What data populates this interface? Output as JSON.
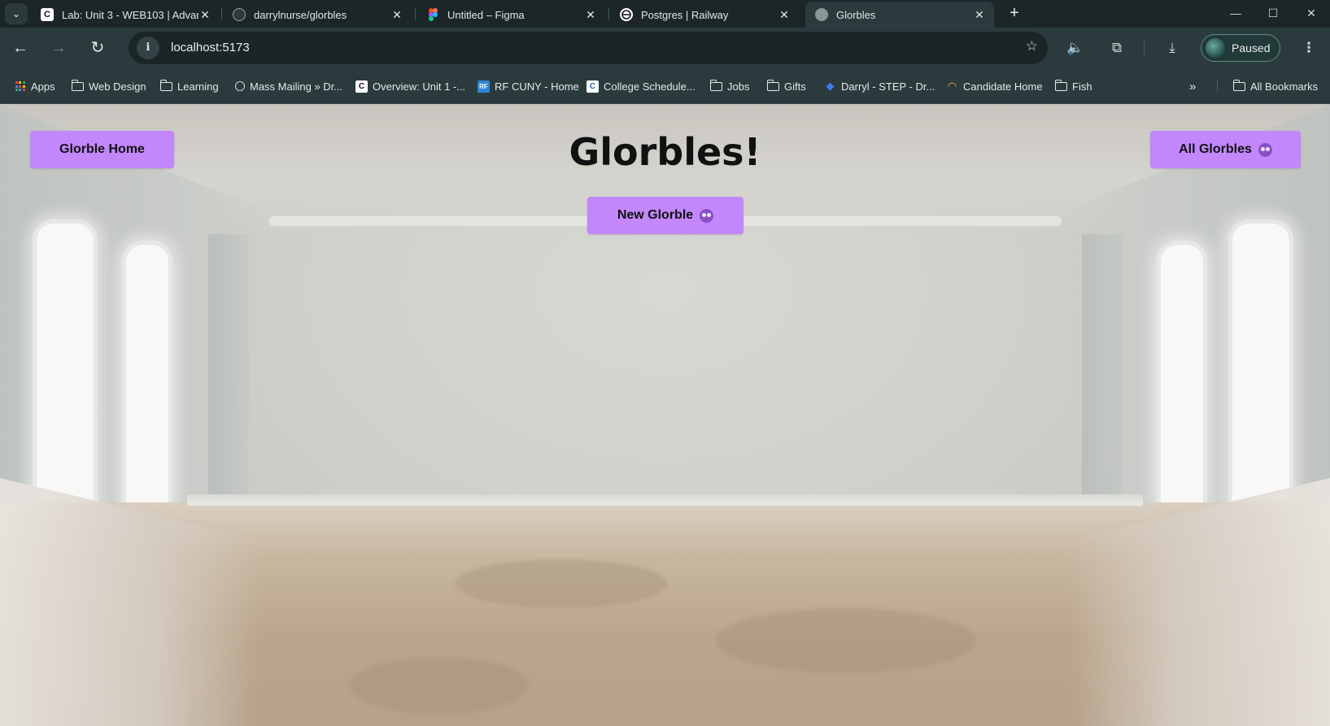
{
  "browser": {
    "tabs": [
      {
        "title": "Lab: Unit 3 - WEB103 | Advar",
        "favicon": "codepath-icon"
      },
      {
        "title": "darrylnurse/glorbles",
        "favicon": "github-icon"
      },
      {
        "title": "Untitled – Figma",
        "favicon": "figma-icon"
      },
      {
        "title": "Postgres | Railway",
        "favicon": "railway-icon"
      },
      {
        "title": "Glorbles",
        "favicon": "glorble-icon",
        "active": true
      }
    ],
    "url": "localhost:5173",
    "profile_label": "Paused",
    "bookmarks": [
      {
        "label": "Apps",
        "icon": "apps-grid-icon"
      },
      {
        "label": "Web Design",
        "icon": "folder-icon"
      },
      {
        "label": "Learning",
        "icon": "folder-icon"
      },
      {
        "label": "Mass Mailing » Dr...",
        "icon": "github-icon"
      },
      {
        "label": "Overview: Unit 1 -...",
        "icon": "codepath-icon"
      },
      {
        "label": "RF CUNY - Home",
        "icon": "rf-icon"
      },
      {
        "label": "College Schedule...",
        "icon": "c-icon"
      },
      {
        "label": "Jobs",
        "icon": "folder-icon"
      },
      {
        "label": "Gifts",
        "icon": "folder-icon"
      },
      {
        "label": "Darryl - STEP - Dr...",
        "icon": "dropbox-icon"
      },
      {
        "label": "Candidate Home",
        "icon": "candidate-icon"
      },
      {
        "label": "Fish",
        "icon": "folder-icon"
      }
    ],
    "all_bookmarks_label": "All Bookmarks"
  },
  "app": {
    "title": "Glorbles!",
    "home_button": "Glorble Home",
    "all_button": "All Glorbles",
    "new_button": "New Glorble",
    "button_color": "#c187fb"
  }
}
